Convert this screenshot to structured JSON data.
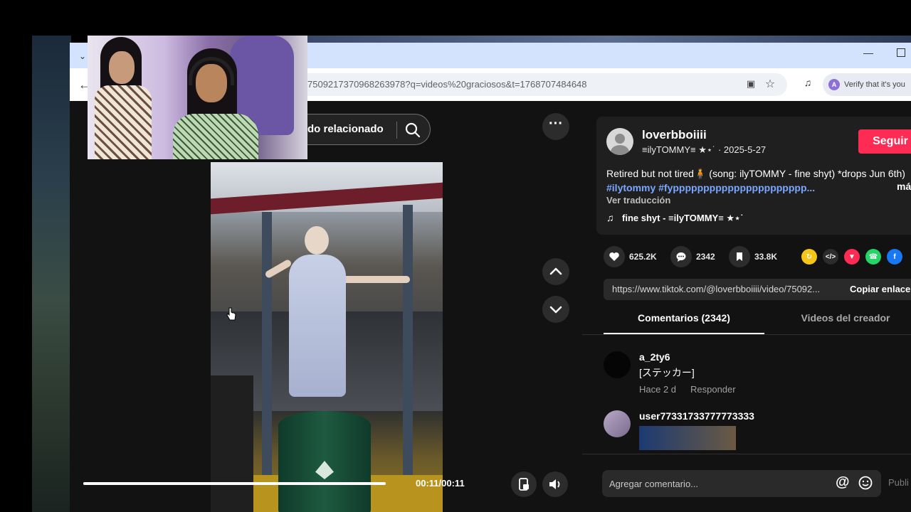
{
  "browser": {
    "url": "750921737096826397​8?q=videos%20graciosos&t=1768707484648",
    "verify_text": "Verify that it's you",
    "verify_initial": "A"
  },
  "video": {
    "search_related": "do relacionado",
    "time": "00:11/00:11",
    "progress": 1.0
  },
  "post": {
    "username": "loverbboiiii",
    "subline": "≡ilyTOMMY≡ ★⋆˙ · 2025-5-27",
    "follow_label": "Seguir",
    "description": "Retired but not tired🧍 (song: ilyTOMMY - fine shyt) *drops Jun 6th)",
    "hashtags": "#ilytommy #fypppppppppppppppppppppp...",
    "more": "má",
    "translate": "Ver traducción",
    "music_note": "♫",
    "music": "fine shyt - ≡ilyTOMMY≡ ★⋆˙"
  },
  "stats": {
    "likes": "625.2K",
    "comments": "2342",
    "saves": "33.8K"
  },
  "share": {
    "link": "https://www.tiktok.com/@loverbboiiii/video/75092...",
    "copy_label": "Copiar enlace"
  },
  "tabs": {
    "comments": "Comentarios (2342)",
    "creator_videos": "Videos del creador"
  },
  "comments": [
    {
      "user": "a_2ty6",
      "text": "[ステッカー]",
      "time": "Hace 2 d",
      "reply": "Responder"
    },
    {
      "user": "user77331733777773333",
      "text": "",
      "time": "",
      "reply": ""
    }
  ],
  "composer": {
    "placeholder": "Agregar comentario...",
    "at": "@",
    "publish": "Publi"
  },
  "colors": {
    "accent": "#fe2c55",
    "hashtag": "#7aa7ff",
    "panel": "#121212"
  }
}
